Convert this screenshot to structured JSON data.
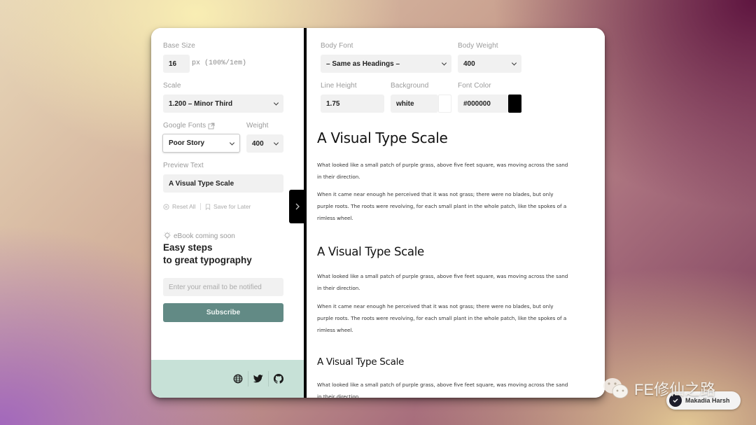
{
  "sidebar": {
    "base_size": {
      "label": "Base Size",
      "value": "16",
      "unit": "px (100%/1em)"
    },
    "scale": {
      "label": "Scale",
      "value": "1.200 – Minor Third"
    },
    "google_fonts": {
      "label": "Google Fonts",
      "value": "Poor Story",
      "icon": "external-link-icon"
    },
    "weight": {
      "label": "Weight",
      "value": "400"
    },
    "preview_text": {
      "label": "Preview Text",
      "value": "A Visual Type Scale"
    },
    "actions": {
      "reset": "Reset All",
      "save": "Save for Later"
    },
    "ebook": {
      "tag": "eBook coming soon",
      "title_line1": "Easy steps",
      "title_line2": "to great typography",
      "email_placeholder": "Enter your email to be notified",
      "subscribe": "Subscribe"
    },
    "footer_icons": [
      "globe-icon",
      "twitter-icon",
      "github-icon"
    ]
  },
  "toggle": {
    "icon": "chevron-right-icon"
  },
  "controls": {
    "body_font": {
      "label": "Body Font",
      "value": "– Same as Headings –"
    },
    "body_weight": {
      "label": "Body Weight",
      "value": "400"
    },
    "line_height": {
      "label": "Line Height",
      "value": "1.75"
    },
    "background": {
      "label": "Background",
      "value": "white",
      "swatch": "#ffffff"
    },
    "font_color": {
      "label": "Font Color",
      "value": "#000000",
      "swatch": "#000000"
    }
  },
  "preview": {
    "sections": [
      {
        "heading": "A Visual Type Scale",
        "p1": "What looked like a small patch of purple grass, above five feet square, was moving across the sand in their direction.",
        "p2": "When it came near enough he perceived that it was not grass; there were no blades, but only purple roots. The roots were revolving, for each small plant in the whole patch, like the spokes of a rimless wheel."
      },
      {
        "heading": "A Visual Type Scale",
        "p1": "What looked like a small patch of purple grass, above five feet square, was moving across the sand in their direction.",
        "p2": "When it came near enough he perceived that it was not grass; there were no blades, but only purple roots. The roots were revolving, for each small plant in the whole patch, like the spokes of a rimless wheel."
      },
      {
        "heading": "A Visual Type Scale",
        "p1": "What looked like a small patch of purple grass, above five feet square, was moving across the sand in their direction."
      }
    ]
  },
  "overlay": {
    "watermark": "FE修仙之路",
    "author": "Makadia Harsh"
  },
  "colors": {
    "accent": "#628a85",
    "footer": "#c7e1d7",
    "divider": "#000000"
  }
}
